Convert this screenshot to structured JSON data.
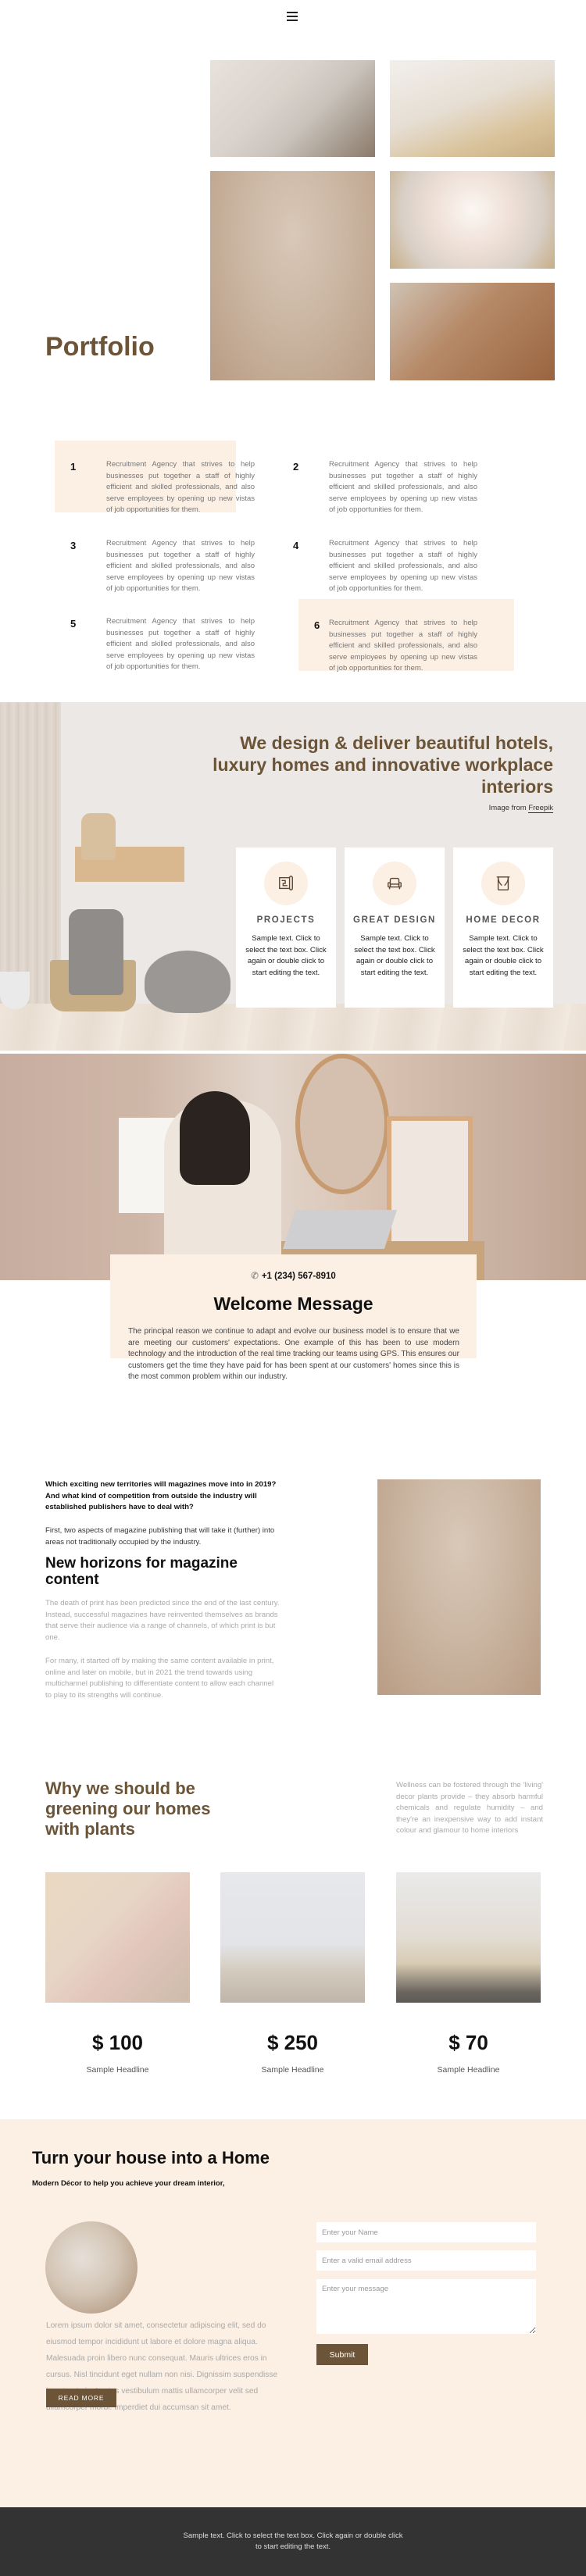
{
  "header": {
    "menu_icon": "hamburger-menu-icon"
  },
  "portfolio": {
    "title": "Portfolio",
    "images": [
      "living-room-photo",
      "table-decor-photo",
      "dried-flowers-stool-photo",
      "roses-basket-photo",
      "table-setting-photo"
    ]
  },
  "features": [
    {
      "num": "1",
      "text": "Recruitment Agency that strives to help businesses put together a staff of highly efficient and skilled professionals, and also serve employees by opening up new vistas of job opportunities for them.",
      "highlighted": true
    },
    {
      "num": "2",
      "text": "Recruitment Agency that strives to help businesses put together a staff of highly efficient and skilled professionals, and also serve employees by opening up new vistas of job opportunities for them.",
      "highlighted": false
    },
    {
      "num": "3",
      "text": "Recruitment Agency that strives to help businesses put together a staff of highly efficient and skilled professionals, and also serve employees by opening up new vistas of job opportunities for them.",
      "highlighted": false
    },
    {
      "num": "4",
      "text": "Recruitment Agency that strives to help businesses put together a staff of highly efficient and skilled professionals, and also serve employees by opening up new vistas of job opportunities for them.",
      "highlighted": false
    },
    {
      "num": "5",
      "text": "Recruitment Agency that strives to help businesses put together a staff of highly efficient and skilled professionals, and also serve employees by opening up new vistas of job opportunities for them.",
      "highlighted": false
    },
    {
      "num": "6",
      "text": "Recruitment Agency that strives to help businesses put together a staff of highly efficient and skilled professionals, and also serve employees by opening up new vistas of job opportunities for them.",
      "highlighted": true
    }
  ],
  "hero": {
    "title": "We design & deliver beautiful hotels, luxury homes and innovative workplace interiors",
    "credit_prefix": "Image from ",
    "credit_link": "Freepik",
    "services": [
      {
        "icon": "blueprint-icon",
        "title": "PROJECTS",
        "text": "Sample text. Click to select the text box. Click again or double click to start editing the text."
      },
      {
        "icon": "armchair-icon",
        "title": "GREAT DESIGN",
        "text": "Sample text. Click to select the text box. Click again or double click to start editing the text."
      },
      {
        "icon": "curtains-icon",
        "title": "HOME DECOR",
        "text": "Sample text. Click to select the text box. Click again or double click to start editing the text."
      }
    ]
  },
  "welcome": {
    "phone_icon": "phone-icon",
    "phone": "+1 (234) 567-8910",
    "title": "Welcome Message",
    "text": "The principal reason we continue to adapt and evolve our business model is to ensure that we are meeting our customers' expectations. One example of this has been to use modern technology and the introduction of the real time tracking our teams using GPS. This ensures our customers get the time they have paid for has been spent at our customers' homes since this is the most common problem within our industry."
  },
  "magazine": {
    "question": "Which exciting new territories will magazines move into in 2019? And what kind of competition from outside the industry will established publishers have to deal with?",
    "intro": "First, two aspects of magazine publishing that will take it (further) into areas not traditionally occupied by the industry.",
    "title": "New horizons for magazine content",
    "p1": "The death of print has been predicted since the end of the last century. Instead, successful magazines have reinvented themselves as brands that serve their audience via a range of channels, of which print is but one.",
    "p2": "For many, it started off by making the same content available in print, online and later on mobile, but in 2021 the trend towards using multichannel publishing to differentiate content to allow each channel to play to its strengths will continue."
  },
  "plants": {
    "title": "Why we should be greening our homes with plants",
    "text": "Wellness can be fostered through the 'living' decor plants provide – they absorb harmful chemicals and regulate humidity – and they're an inexpensive way to add instant colour and glamour to home interiors",
    "products": [
      {
        "price": "$ 100",
        "headline": "Sample Headline"
      },
      {
        "price": "$ 250",
        "headline": "Sample Headline"
      },
      {
        "price": "$ 70",
        "headline": "Sample Headline"
      }
    ]
  },
  "contact": {
    "title": "Turn your house into a Home",
    "subtitle": "Modern Décor to help you achieve your dream interior,",
    "lorem": "Lorem ipsum dolor sit amet, consectetur adipiscing elit, sed do eiusmod tempor incididunt ut labore et dolore magna aliqua. Malesuada proin libero nunc consequat. Mauris ultrices eros in cursus. Nisl tincidunt eget nullam non nisi. Dignissim suspendisse in est ante in. Lectus vestibulum mattis ullamcorper velit sed ullamcorper morbi. Imperdiet dui accumsan sit amet.",
    "read_more": "READ MORE",
    "form": {
      "name_placeholder": "Enter your Name",
      "email_placeholder": "Enter a valid email address",
      "message_placeholder": "Enter your message",
      "submit": "Submit"
    }
  },
  "footer": {
    "text": "Sample text. Click to select the text box. Click again or double click to start editing the text."
  },
  "colors": {
    "brand_brown": "#6b5437",
    "highlight_peach": "#fcefe3",
    "footer_bg": "#333333"
  }
}
